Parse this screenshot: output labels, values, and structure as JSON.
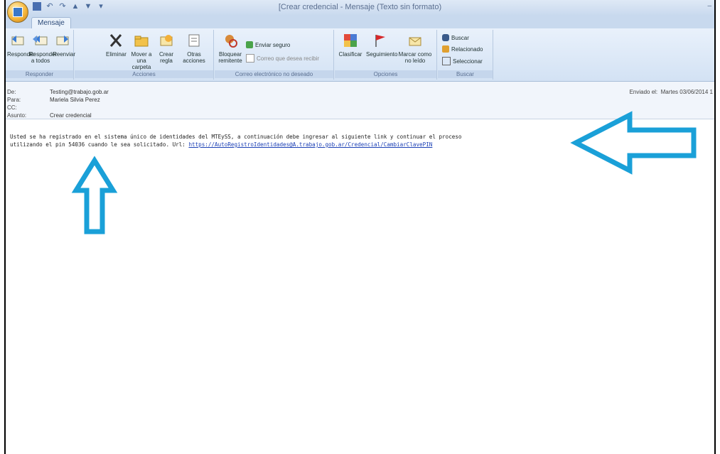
{
  "window": {
    "title": "[Crear credencial - Mensaje (Texto sin formato)",
    "controls": "–"
  },
  "tabs": [
    {
      "label": "Mensaje"
    }
  ],
  "ribbon": {
    "groups": {
      "responder": {
        "label": "Responder",
        "buttons": [
          "Responder",
          "Responder a todos",
          "Reenviar"
        ]
      },
      "acciones": {
        "label": "Acciones",
        "buttons": [
          "Eliminar",
          "Mover a una carpeta",
          "Crear regla",
          "Otras acciones"
        ]
      },
      "correo_no_deseado": {
        "label": "Correo electrónico no deseado",
        "buttons": [
          "Bloquear remitente"
        ],
        "small": [
          "Enviar seguro",
          "Correo que desea recibir"
        ]
      },
      "opciones": {
        "label": "Opciones",
        "buttons": [
          "Clasificar",
          "Seguimiento",
          "Marcar como no leído"
        ]
      },
      "buscar": {
        "label": "Buscar",
        "small": [
          "Buscar",
          "Relacionado",
          "Seleccionar"
        ]
      }
    }
  },
  "header": {
    "de_label": "De:",
    "de_value": "Testing@trabajo.gob.ar",
    "para_label": "Para:",
    "para_value": "Mariela Silvia Perez",
    "cc_label": "CC:",
    "cc_value": "",
    "asunto_label": "Asunto:",
    "asunto_value": "Crear credencial",
    "sent_label": "Enviado el:",
    "sent_value": "Martes 03/06/2014 1"
  },
  "body": {
    "line1": "Usted se ha registrado en el sistema único de identidades del MTEySS, a continuación debe ingresar al siguiente link y continuar el proceso",
    "line2_prefix": "utilizando el pin 54036 cuando le sea solicitado. Url: ",
    "link": "https://AutoRegistroIdentidades@A.trabajo.gob.ar/Credencial/CambiarClavePIN"
  },
  "annotations": [
    {
      "icon": "arrow-up-icon",
      "color": "#1aa0d8"
    },
    {
      "icon": "arrow-left-icon",
      "color": "#1aa0d8"
    }
  ],
  "colors": {
    "accent": "#1aa0d8",
    "link": "#1a3fb5",
    "ribbon": "#dce8f6"
  }
}
